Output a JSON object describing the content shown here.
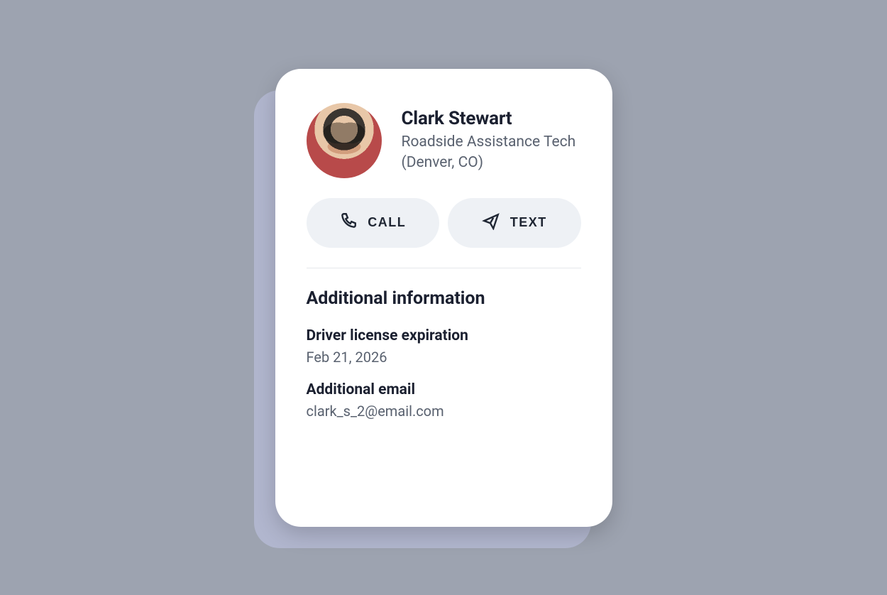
{
  "contact": {
    "name": "Clark Stewart",
    "role": "Roadside Assistance Tech",
    "location": "(Denver, CO)"
  },
  "actions": {
    "call_label": "CALL",
    "text_label": "TEXT"
  },
  "additional": {
    "section_title": "Additional information",
    "fields": [
      {
        "label": "Driver license expiration",
        "value": "Feb 21, 2026"
      },
      {
        "label": "Additional email",
        "value": "clark_s_2@email.com"
      }
    ]
  }
}
